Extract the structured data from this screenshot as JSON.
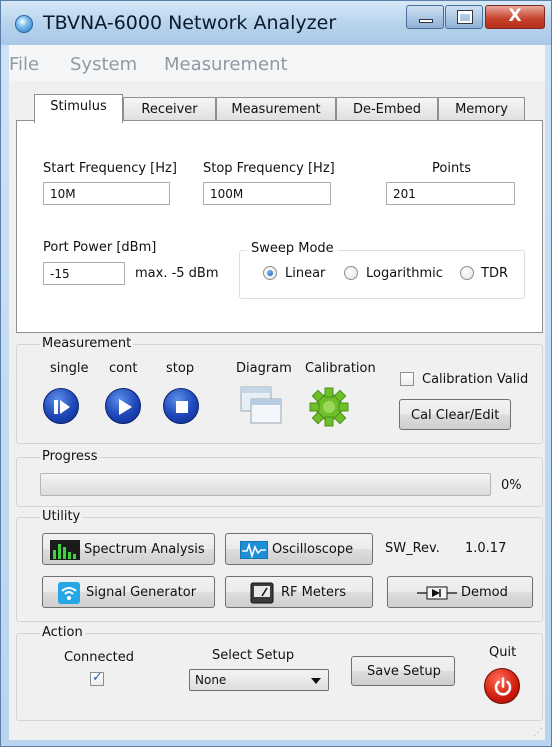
{
  "window": {
    "title": "TBVNA-6000 Network Analyzer"
  },
  "menu": [
    "File",
    "System",
    "Measurement"
  ],
  "tabs": [
    "Stimulus",
    "Receiver",
    "Measurement",
    "De-Embed",
    "Memory"
  ],
  "stimulus": {
    "start_label": "Start Frequency [Hz]",
    "start_value": "10M",
    "stop_label": "Stop Frequency [Hz]",
    "stop_value": "100M",
    "points_label": "Points",
    "points_value": "201",
    "power_label": "Port  Power [dBm]",
    "power_value": "-15",
    "power_max": "max. -5 dBm",
    "sweep_mode_label": "Sweep Mode",
    "sweep_modes": [
      "Linear",
      "Logarithmic",
      "TDR"
    ],
    "sweep_selected": "Linear"
  },
  "measurement": {
    "title": "Measurement",
    "single_label": "single",
    "cont_label": "cont",
    "stop_label": "stop",
    "diagram_label": "Diagram",
    "calibration_label": "Calibration",
    "cal_valid_label": "Calibration Valid",
    "cal_valid_checked": false,
    "cal_clear_label": "Cal Clear/Edit"
  },
  "progress": {
    "title": "Progress",
    "value_text": "0%",
    "fraction": 0
  },
  "utility": {
    "title": "Utility",
    "spectrum_label": "Spectrum Analysis",
    "oscilloscope_label": "Oscilloscope",
    "sw_rev_label": "SW_Rev.",
    "sw_rev_value": "1.0.17",
    "siggen_label": "Signal Generator",
    "rfmeters_label": "RF Meters",
    "demod_label": "Demod"
  },
  "action": {
    "title": "Action",
    "connected_label": "Connected",
    "connected_checked": true,
    "select_setup_label": "Select Setup",
    "select_setup_value": "None",
    "save_setup_label": "Save Setup",
    "quit_label": "Quit"
  },
  "colors": {
    "titlebar": "#b7d2ec",
    "progress_fill": "#06b025",
    "round_button": "#1d46b8",
    "quit_red": "#d01b0c",
    "gear_green": "#6fbf2a"
  }
}
